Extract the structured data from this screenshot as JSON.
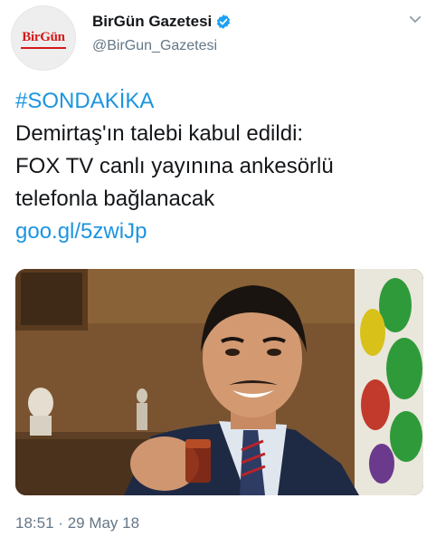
{
  "account": {
    "avatar_text": "BirGün",
    "name": "BirGün Gazetesi",
    "handle": "@BirGun_Gazetesi"
  },
  "tweet": {
    "hashtag": "#SONDAKİKA",
    "lines": [
      "Demirtaş'ın talebi kabul edildi:",
      "FOX TV canlı yayınına ankesörlü",
      "telefonla bağlanacak"
    ],
    "link": "goo.gl/5zwiJp"
  },
  "meta": {
    "time": "18:51",
    "separator": "·",
    "date": "29 May 18"
  },
  "icons": {
    "verified": "verified-badge-icon",
    "menu": "chevron-down-icon"
  },
  "colors": {
    "link": "#1b95e0",
    "secondary_text": "#657786",
    "verified": "#1da1f2",
    "brand_red": "#d31a1a"
  }
}
